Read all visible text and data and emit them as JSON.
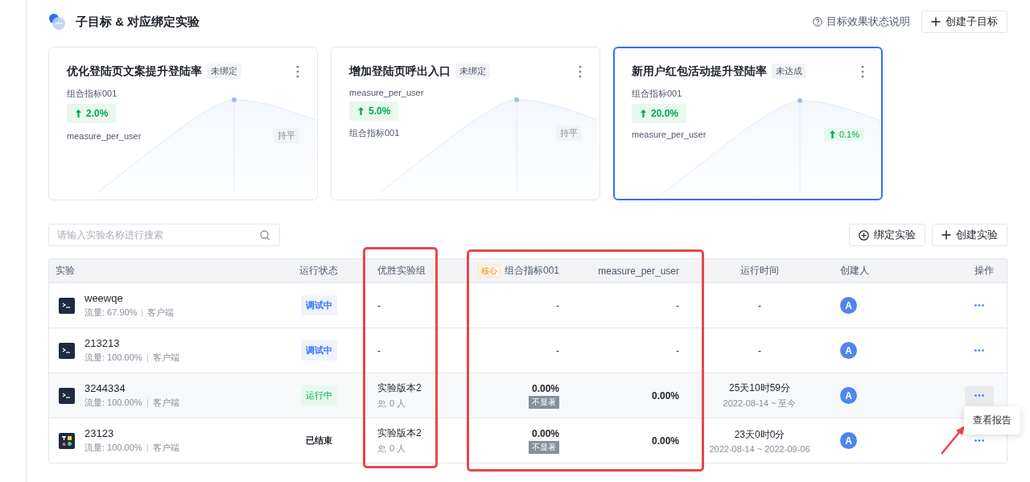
{
  "header": {
    "title": "子目标 & 对应绑定实验",
    "help_link": "目标效果状态说明",
    "create_button": "创建子目标"
  },
  "goals": [
    {
      "title": "优化登陆页文案提升登陆率",
      "tag": "未绑定",
      "selected": false,
      "primary_metric": "组合指标001",
      "primary_change": "2.0%",
      "secondary_metric": "measure_per_user",
      "secondary_result": {
        "kind": "flat",
        "text": "持平"
      }
    },
    {
      "title": "增加登陆页呼出入口",
      "tag": "未绑定",
      "selected": false,
      "primary_metric": "measure_per_user",
      "primary_change": "5.0%",
      "secondary_metric": "组合指标001",
      "secondary_result": {
        "kind": "flat",
        "text": "持平"
      }
    },
    {
      "title": "新用户红包活动提升登陆率",
      "tag": "未达成",
      "selected": true,
      "primary_metric": "组合指标001",
      "primary_change": "20.0%",
      "secondary_metric": "measure_per_user",
      "secondary_result": {
        "kind": "up",
        "text": "0.1%"
      }
    }
  ],
  "search": {
    "placeholder": "请输入实验名称进行搜索"
  },
  "toolbar_buttons": [
    {
      "kind": "bind",
      "label": "绑定实验"
    },
    {
      "kind": "create",
      "label": "创建实验"
    }
  ],
  "table": {
    "columns": [
      {
        "label": "实验"
      },
      {
        "label": "运行状态"
      },
      {
        "label": "优胜实验组"
      },
      {
        "label": "组合指标001",
        "tag": "核心"
      },
      {
        "label": "measure_per_user"
      },
      {
        "label": "运行时间"
      },
      {
        "label": "创建人"
      },
      {
        "label": "操作"
      }
    ],
    "rows": [
      {
        "kind": "terminal",
        "name": "weewqe",
        "traffic": "流量: 67.90%",
        "platform": "客户端",
        "status": {
          "kind": "debug",
          "text": "调试中"
        },
        "winner": {
          "text": "-"
        },
        "metric_1": {
          "value": "-"
        },
        "metric_2": "-",
        "duration": {
          "text": "-"
        },
        "creator": "A",
        "hovered": false
      },
      {
        "kind": "terminal",
        "name": "213213",
        "traffic": "流量: 100.00%",
        "platform": "客户端",
        "status": {
          "kind": "debug",
          "text": "调试中"
        },
        "winner": {
          "text": "-"
        },
        "metric_1": {
          "value": "-"
        },
        "metric_2": "-",
        "duration": {
          "text": "-"
        },
        "creator": "A",
        "hovered": false
      },
      {
        "kind": "terminal",
        "name": "3244334",
        "traffic": "流量: 100.00%",
        "platform": "客户端",
        "status": {
          "kind": "running",
          "text": "运行中"
        },
        "winner": {
          "text": "实验版本2",
          "count": "0 人"
        },
        "metric_1": {
          "value": "0.00%",
          "tag": "不显著"
        },
        "metric_2": "0.00%",
        "duration": {
          "text": "25天10时59分",
          "range": "2022-08-14 ~ 至今"
        },
        "creator": "A",
        "hovered": true
      },
      {
        "kind": "template",
        "name": "23123",
        "traffic": "流量: 100.00%",
        "platform": "客户端",
        "status": {
          "kind": "ended",
          "text": "已结束"
        },
        "winner": {
          "text": "实验版本2",
          "count": "0 人"
        },
        "metric_1": {
          "value": "0.00%",
          "tag": "不显著"
        },
        "metric_2": "0.00%",
        "duration": {
          "text": "23天0时0分",
          "range": "2022-08-14 ~ 2022-09-06"
        },
        "creator": "A",
        "hovered": false
      }
    ]
  },
  "popover": {
    "label": "查看报告"
  }
}
